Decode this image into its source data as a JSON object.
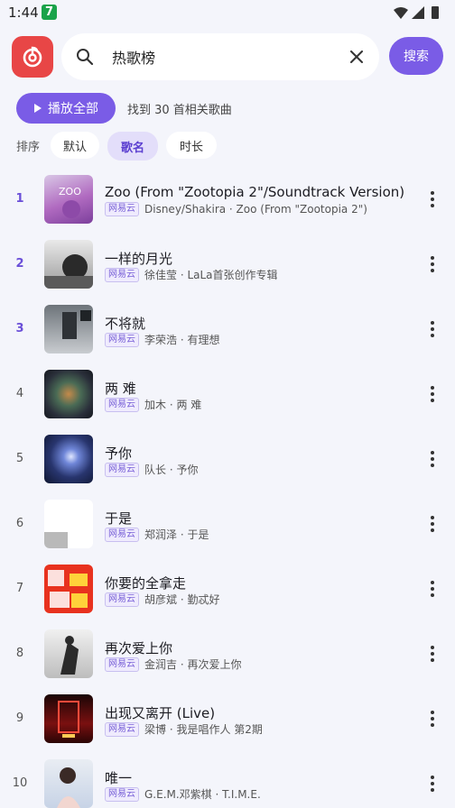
{
  "status": {
    "time": "1:44",
    "badge": "7"
  },
  "search": {
    "query": "热歌榜",
    "button_label": "搜索"
  },
  "actions": {
    "play_all_label": "播放全部",
    "result_text": "找到 30 首相关歌曲"
  },
  "sort": {
    "label": "排序",
    "options": [
      "默认",
      "歌名",
      "时长"
    ],
    "selected": "歌名"
  },
  "source_tag": "网易云",
  "songs": [
    {
      "rank": "1",
      "title": "Zoo (From \"Zootopia 2\"/Soundtrack Version)",
      "meta": "Disney/Shakira · Zoo (From \"Zootopia 2\")"
    },
    {
      "rank": "2",
      "title": "一样的月光",
      "meta": "徐佳莹 · LaLa首张创作专辑"
    },
    {
      "rank": "3",
      "title": "不将就",
      "meta": "李荣浩 · 有理想"
    },
    {
      "rank": "4",
      "title": "两 难",
      "meta": "加木 · 两 难"
    },
    {
      "rank": "5",
      "title": "予你",
      "meta": "队长 · 予你"
    },
    {
      "rank": "6",
      "title": "于是",
      "meta": "郑润泽 · 于是"
    },
    {
      "rank": "7",
      "title": "你要的全拿走",
      "meta": "胡彦斌 · 勤忒好"
    },
    {
      "rank": "8",
      "title": "再次爱上你",
      "meta": "金润吉 · 再次爱上你"
    },
    {
      "rank": "9",
      "title": "出现又离开 (Live)",
      "meta": "梁博 · 我是唱作人 第2期"
    },
    {
      "rank": "10",
      "title": "唯一",
      "meta": "G.E.M.邓紫棋 · T.I.M.E."
    }
  ],
  "colors": {
    "accent": "#7a5ce6",
    "logo_red": "#e84646",
    "background": "#f4f5fb"
  }
}
